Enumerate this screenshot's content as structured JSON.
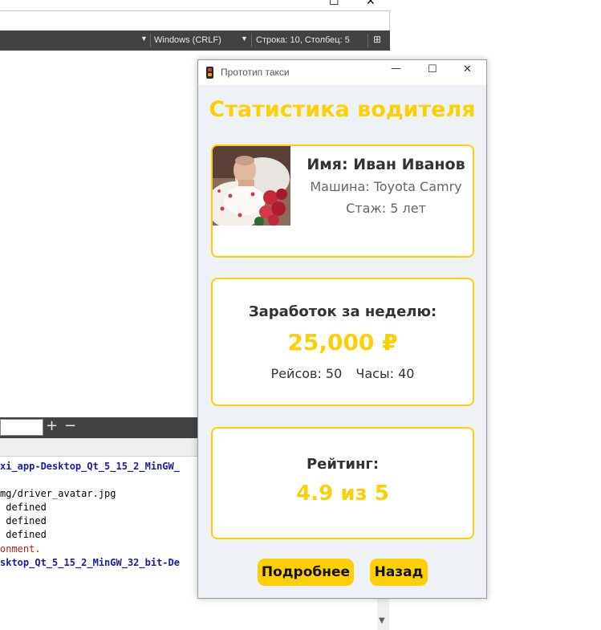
{
  "ide": {
    "status": {
      "line_ending": "Windows (CRLF)",
      "position": "Строка: 10, Столбец: 5"
    },
    "midbar": {
      "plus": "+",
      "minus": "−"
    },
    "output_lines": [
      {
        "text": "xi_app-Desktop_Qt_5_15_2_MinGW_",
        "cls": "c-blue"
      },
      {
        "text": "mg/driver_avatar.jpg",
        "cls": "c-black"
      },
      {
        "text": " defined",
        "cls": "c-black"
      },
      {
        "text": " defined",
        "cls": "c-black"
      },
      {
        "text": " defined",
        "cls": "c-black"
      },
      {
        "text": "onment.",
        "cls": "c-red"
      },
      {
        "text": "sktop_Qt_5_15_2_MinGW_32_bit-De",
        "cls": "c-blue"
      }
    ]
  },
  "app": {
    "window_title": "Прототип такси",
    "page_title": "Статистика водителя",
    "profile": {
      "name": "Имя: Иван Иванов",
      "car": "Машина: Toyota Camry",
      "experience": "Стаж: 5 лет"
    },
    "earnings": {
      "label": "Заработок за неделю:",
      "value": "25,000 ₽",
      "trips": "Рейсов: 50",
      "hours": "Часы: 40"
    },
    "rating": {
      "label": "Рейтинг:",
      "value": "4.9 из 5"
    },
    "buttons": {
      "details": "Подробнее",
      "back": "Назад"
    }
  },
  "colors": {
    "accent": "#fdd005",
    "background": "#eef2f6",
    "ide_bar": "#404244"
  }
}
